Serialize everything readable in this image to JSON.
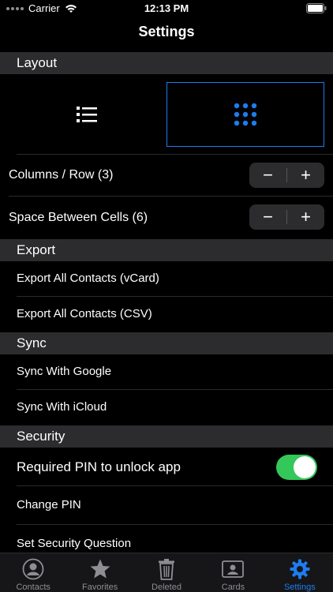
{
  "status_bar": {
    "carrier": "Carrier",
    "time": "12:13 PM"
  },
  "nav": {
    "title": "Settings"
  },
  "layout": {
    "header": "Layout",
    "options": [
      {
        "icon": "list-icon",
        "selected": false
      },
      {
        "icon": "grid-icon",
        "selected": true
      }
    ],
    "columns_label": "Columns / Row  (3)",
    "spacing_label": "Space Between Cells  (6)",
    "stepper": {
      "minus": "−",
      "plus": "+"
    }
  },
  "export": {
    "header": "Export",
    "items": [
      "Export All Contacts (vCard)",
      "Export All Contacts (CSV)"
    ]
  },
  "sync": {
    "header": "Sync",
    "items": [
      "Sync With Google",
      "Sync With iCloud"
    ]
  },
  "security": {
    "header": "Security",
    "pin_label": "Required PIN to unlock app",
    "pin_enabled": true,
    "items": [
      "Change PIN",
      "Set Security Question"
    ]
  },
  "tabs": [
    {
      "label": "Contacts",
      "icon": "person-icon",
      "active": false
    },
    {
      "label": "Favorites",
      "icon": "star-icon",
      "active": false
    },
    {
      "label": "Deleted",
      "icon": "trash-icon",
      "active": false
    },
    {
      "label": "Cards",
      "icon": "card-icon",
      "active": false
    },
    {
      "label": "Settings",
      "icon": "gear-icon",
      "active": true
    }
  ],
  "colors": {
    "accent": "#1e7cf0",
    "toggle_on": "#34c759",
    "section_bg": "#2c2c2e"
  }
}
